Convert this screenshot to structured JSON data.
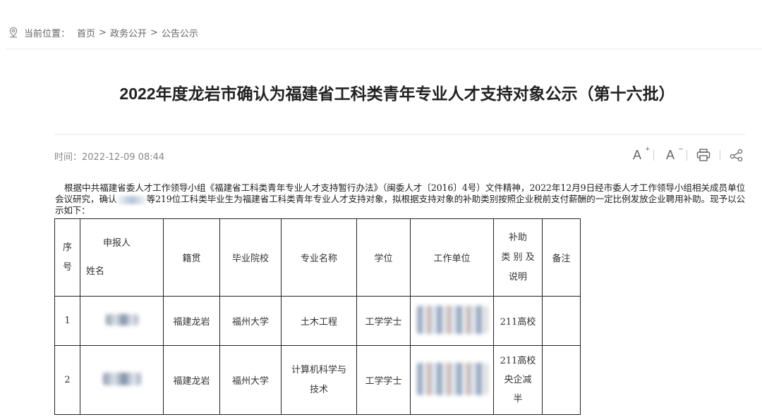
{
  "breadcrumb": {
    "prefix": "当前位置：",
    "items": [
      "首页",
      "政务公开",
      "公告公示"
    ],
    "separator": ">"
  },
  "article": {
    "title": "2022年度龙岩市确认为福建省工科类青年专业人才支持对象公示（第十六批）",
    "time_label": "时间：2022-12-09 08:44",
    "intro_part1": "根据中共福建省委人才工作领导小组《福建省工科类青年专业人才支持暂行办法》（闽委人才〔2016〕4号）文件精神，2022年12月9日经市委人才工作领导小组相关成员单位会议研究，确认",
    "intro_part2": "等219位工科类毕业生为福建省工科类青年专业人才支持对象，拟根据支持对象的补助类别按照企业税前支付薪酬的一定比例发放企业聘用补助。现予以公示如下："
  },
  "tools": {
    "font_increase": "A",
    "font_decrease": "A",
    "plus": "+",
    "minus": "−",
    "print_icon": "printer-icon",
    "share_icon": "share-icon"
  },
  "table": {
    "headers": {
      "seq_line1": "序",
      "seq_line2": "号",
      "applicant_line1": "申报人",
      "applicant_line2": "姓名",
      "native": "籍贯",
      "school": "毕业院校",
      "major": "专业名称",
      "degree": "学位",
      "employer": "工作单位",
      "subsidy_line1": "补助",
      "subsidy_line2": "类 别 及",
      "subsidy_line3": "说明",
      "remark": "备注"
    },
    "rows": [
      {
        "seq": "1",
        "native": "福建龙岩",
        "school": "福州大学",
        "major_line1": "土木工程",
        "major_line2": "",
        "degree": "工学学士",
        "subsidy_line1": "211高校",
        "subsidy_line2": "",
        "subsidy_line3": "",
        "remark": ""
      },
      {
        "seq": "2",
        "native": "福建龙岩",
        "school": "福州大学",
        "major_line1": "计算机科学与",
        "major_line2": "技术",
        "degree": "工学学士",
        "subsidy_line1": "211高校",
        "subsidy_line2": "央企减",
        "subsidy_line3": "半",
        "remark": ""
      }
    ]
  }
}
